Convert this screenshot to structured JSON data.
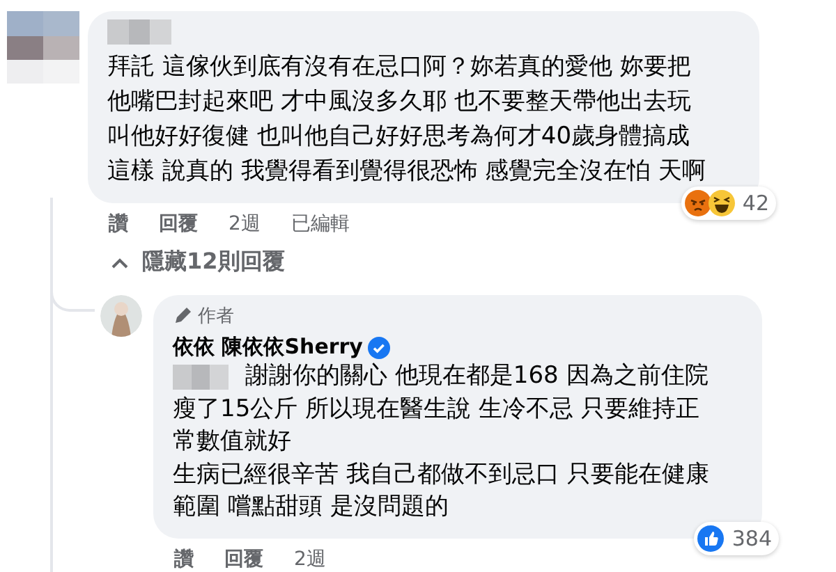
{
  "comments": [
    {
      "lines": [
        "拜託 這傢伙到底有沒有在忌口阿？妳若真的愛他 妳要把",
        "他嘴巴封起來吧 才中風沒多久耶 也不要整天帶他出去玩",
        "叫他好好復健 也叫他自己好好思考為何才40歲身體搞成",
        "這樣 說真的 我覺得看到覺得很恐怖 感覺完全沒在怕 天啊"
      ],
      "reactions": {
        "kinds": [
          {
            "kind": "angry"
          },
          {
            "kind": "haha"
          }
        ],
        "count": "42"
      },
      "actions": [
        "讚",
        "回覆",
        "2週",
        "已編輯"
      ],
      "toggle": "隱藏12則回覆"
    },
    {
      "author_badge": "作者",
      "author": "依依 陳依依Sherry",
      "verified": true,
      "mention": true,
      "lines": [
        "謝謝你的關心 他現在都是168 因為之前住院",
        "瘦了15公斤 所以現在醫生說 生冷不忌 只要維持正",
        "常數值就好",
        "生病已經很辛苦 我自己都做不到忌口 只要能在健康",
        "範圍 嚐點甜頭 是沒問題的"
      ],
      "reactions": {
        "kinds": [
          {
            "kind": "like"
          }
        ],
        "count": "384"
      },
      "actions": [
        "讚",
        "回覆",
        "2週"
      ]
    }
  ]
}
